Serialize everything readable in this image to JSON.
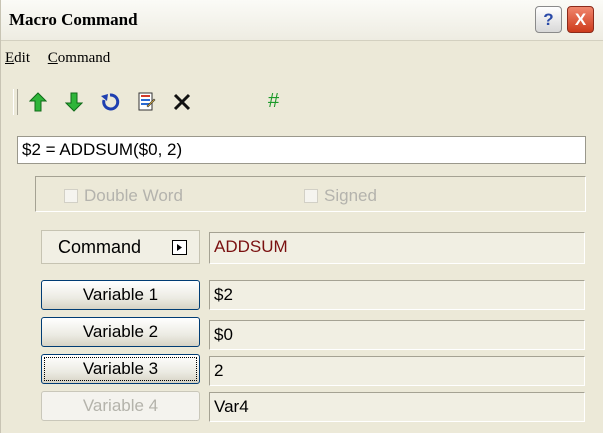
{
  "window": {
    "title": "Macro Command"
  },
  "title_buttons": {
    "help": "?",
    "close": "X"
  },
  "menu": {
    "items": [
      {
        "mnemonic": "E",
        "rest": "dit"
      },
      {
        "mnemonic": "C",
        "rest": "ommand"
      }
    ]
  },
  "toolbar": {
    "icons": [
      "arrow-up-icon",
      "arrow-down-icon",
      "undo-icon",
      "edit-document-icon",
      "delete-icon"
    ],
    "hash_label": "#"
  },
  "expression": {
    "value": "$2 = ADDSUM($0, 2)"
  },
  "options": {
    "double_word": "Double Word",
    "signed": "Signed"
  },
  "command": {
    "label": "Command",
    "value": "ADDSUM"
  },
  "variables": [
    {
      "label": "Variable 1",
      "value": "$2",
      "enabled": true
    },
    {
      "label": "Variable 2",
      "value": "$0",
      "enabled": true
    },
    {
      "label": "Variable 3",
      "value": "2",
      "enabled": true
    },
    {
      "label": "Variable 4",
      "value": "Var4",
      "enabled": false
    }
  ],
  "colors": {
    "window_bg": "#ece9d8",
    "close_red": "#cd3a1c",
    "arrow_green": "#1c9a2a",
    "command_text": "#7a1010"
  }
}
